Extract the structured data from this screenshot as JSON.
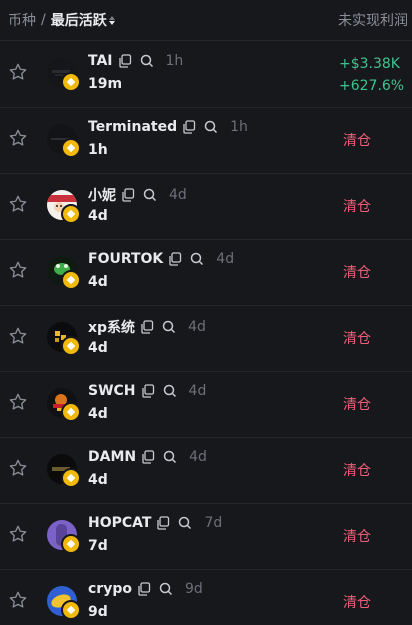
{
  "header": {
    "crumb_token": "币种",
    "crumb_sep": "/",
    "crumb_active": "最后活跃",
    "right_col": "未实现利润"
  },
  "colors": {
    "profit": "#3ec48d",
    "cleared": "#f05f79",
    "badge": "#f0b90b"
  },
  "rows": [
    {
      "name": "TAI",
      "age": "1h",
      "time": "19m",
      "pnl_usd": "+$3.38K",
      "pnl_pct": "+627.6%"
    },
    {
      "name": "Terminated",
      "age": "1h",
      "time": "1h",
      "status": "清仓"
    },
    {
      "name": "小妮",
      "age": "4d",
      "time": "4d",
      "status": "清仓"
    },
    {
      "name": "FOURTOK",
      "age": "4d",
      "time": "4d",
      "status": "清仓"
    },
    {
      "name": "xp系统",
      "age": "4d",
      "time": "4d",
      "status": "清仓"
    },
    {
      "name": "SWCH",
      "age": "4d",
      "time": "4d",
      "status": "清仓"
    },
    {
      "name": "DAMN",
      "age": "4d",
      "time": "4d",
      "status": "清仓"
    },
    {
      "name": "HOPCAT",
      "age": "7d",
      "time": "7d",
      "status": "清仓"
    },
    {
      "name": "crypo",
      "age": "9d",
      "time": "9d",
      "status": "清仓"
    }
  ]
}
